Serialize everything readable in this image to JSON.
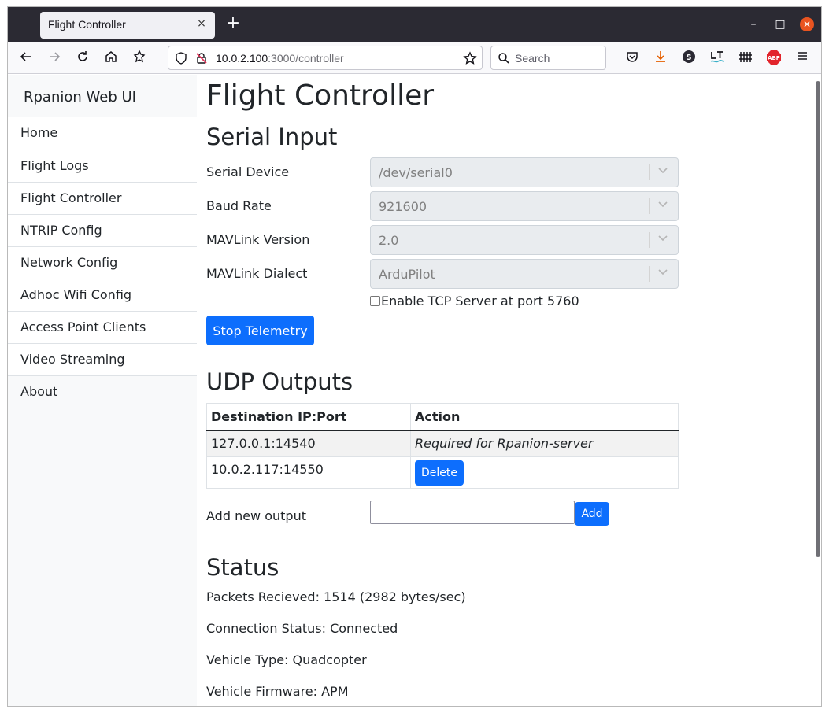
{
  "browser": {
    "tab_title": "Flight Controller",
    "tab_close": "×",
    "new_tab": "+",
    "url_host": "10.0.2.100",
    "url_path": ":3000/controller",
    "search_placeholder": "Search",
    "window_min": "–",
    "window_max": "□",
    "window_close": "✕"
  },
  "sidebar": {
    "brand": "Rpanion Web UI",
    "items": [
      {
        "label": "Home"
      },
      {
        "label": "Flight Logs"
      },
      {
        "label": "Flight Controller"
      },
      {
        "label": "NTRIP Config"
      },
      {
        "label": "Network Config"
      },
      {
        "label": "Adhoc Wifi Config"
      },
      {
        "label": "Access Point Clients"
      },
      {
        "label": "Video Streaming"
      },
      {
        "label": "About"
      }
    ]
  },
  "main": {
    "title": "Flight Controller",
    "serial_input": {
      "heading": "Serial Input",
      "fields": [
        {
          "label": "Serial Device",
          "value": "/dev/serial0"
        },
        {
          "label": "Baud Rate",
          "value": "921600"
        },
        {
          "label": "MAVLink Version",
          "value": "2.0"
        },
        {
          "label": "MAVLink Dialect",
          "value": "ArduPilot"
        }
      ],
      "tcp_checkbox_label": "Enable TCP Server at port 5760",
      "stop_button": "Stop Telemetry"
    },
    "udp_outputs": {
      "heading": "UDP Outputs",
      "columns": [
        "Destination IP:Port",
        "Action"
      ],
      "rows": [
        {
          "dest": "127.0.0.1:14540",
          "action": "Required for Rpanion-server"
        },
        {
          "dest": "10.0.2.117:14550",
          "action": "Delete"
        }
      ],
      "add_label": "Add new output",
      "add_value": "",
      "add_button": "Add"
    },
    "status": {
      "heading": "Status",
      "lines": [
        "Packets Recieved: 1514 (2982 bytes/sec)",
        "Connection Status: Connected",
        "Vehicle Type: Quadcopter",
        "Vehicle Firmware: APM"
      ]
    }
  },
  "colors": {
    "primary": "#0d6efd",
    "ubuntu_close": "#e95420",
    "tabbar": "#2b2a33"
  }
}
